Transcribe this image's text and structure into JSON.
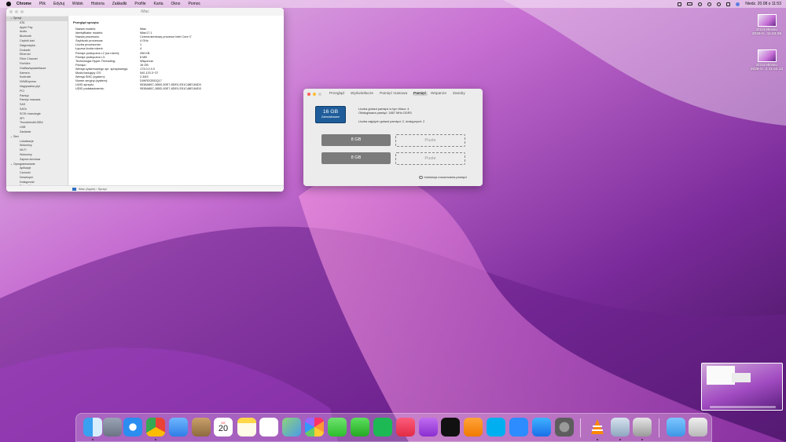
{
  "menubar": {
    "items": [
      "Chrome",
      "Plik",
      "Edytuj",
      "Widok",
      "Historia",
      "Zakładki",
      "Profile",
      "Karta",
      "Okno",
      "Pomoc"
    ],
    "clock": "Niedz. 20.08 o 11:53",
    "icons": [
      "screen-mirror-icon",
      "battery-icon",
      "wifi-icon",
      "bluetooth-icon",
      "search-icon",
      "control-center-icon",
      "siri-icon"
    ]
  },
  "sysinfo": {
    "title": "iMac",
    "sidebar": [
      {
        "label": "Sprzęt",
        "type": "h",
        "selected": true
      },
      {
        "label": "ATA",
        "type": "c"
      },
      {
        "label": "Apple Pay",
        "type": "c"
      },
      {
        "label": "Audio",
        "type": "c"
      },
      {
        "label": "Bluetooth",
        "type": "c"
      },
      {
        "label": "Czytnik kart",
        "type": "c"
      },
      {
        "label": "Diagnostyka",
        "type": "c"
      },
      {
        "label": "Drukarki",
        "type": "c"
      },
      {
        "label": "Ethernet",
        "type": "c"
      },
      {
        "label": "Fibre Channel",
        "type": "c"
      },
      {
        "label": "FireWire",
        "type": "c"
      },
      {
        "label": "Grafika/wyświetlacze",
        "type": "c"
      },
      {
        "label": "Kamera",
        "type": "c"
      },
      {
        "label": "Kontroler",
        "type": "c"
      },
      {
        "label": "NVMExpress",
        "type": "c"
      },
      {
        "label": "Nagrywarka płyt",
        "type": "c"
      },
      {
        "label": "PCI",
        "type": "c"
      },
      {
        "label": "Pamięć",
        "type": "c"
      },
      {
        "label": "Pamięć masowa",
        "type": "c"
      },
      {
        "label": "SAS",
        "type": "c"
      },
      {
        "label": "SATA",
        "type": "c"
      },
      {
        "label": "SCSI równoległe",
        "type": "c"
      },
      {
        "label": "SPI",
        "type": "c"
      },
      {
        "label": "Thunderbolt/USB4",
        "type": "c"
      },
      {
        "label": "USB",
        "type": "c"
      },
      {
        "label": "Zasilanie",
        "type": "c"
      },
      {
        "label": "Sieć",
        "type": "h"
      },
      {
        "label": "Lokalizacje",
        "type": "c"
      },
      {
        "label": "Woluminy",
        "type": "c"
      },
      {
        "label": "Wi-Fi",
        "type": "c"
      },
      {
        "label": "Woluminy",
        "type": "c"
      },
      {
        "label": "Zapora sieciowa",
        "type": "c"
      },
      {
        "label": "Oprogramowanie",
        "type": "h"
      },
      {
        "label": "Aplikacje",
        "type": "c"
      },
      {
        "label": "Czcionki",
        "type": "c"
      },
      {
        "label": "Deweloper",
        "type": "c"
      },
      {
        "label": "Dostępność",
        "type": "c"
      },
      {
        "label": "Dzienniki",
        "type": "c"
      }
    ],
    "content_title": "Przegląd sprzętu:",
    "rows": [
      {
        "k": "Nazwa modelu:",
        "v": "iMac"
      },
      {
        "k": "Identyfikator modelu:",
        "v": "iMac17,1"
      },
      {
        "k": "Nazwa procesora:",
        "v": "Czterordzeniowy procesor Intel Core i7"
      },
      {
        "k": "Szybkość procesora:",
        "v": "4 GHz"
      },
      {
        "k": "Liczba procesorów:",
        "v": "1"
      },
      {
        "k": "Łączna liczba rdzeni:",
        "v": "4"
      },
      {
        "k": "Pamięć podręczna L2 (na rdzeń):",
        "v": "256 KB"
      },
      {
        "k": "Pamięć podręczna L3:",
        "v": "8 MB"
      },
      {
        "k": "Technologia Hyper-Threading:",
        "v": "Włączona"
      },
      {
        "k": "Pamięć:",
        "v": "16 GB"
      },
      {
        "k": "Wersja systemowego opr. sprzętowego:",
        "v": "173.0.0.0.0"
      },
      {
        "k": "Moduł ładujący OS:",
        "v": "540.120.3~37"
      },
      {
        "k": "Wersja SMC (system):",
        "v": "2.34f3"
      },
      {
        "k": "Numer seryjny (system):",
        "v": "D0KR2GBGQ17"
      },
      {
        "k": "UUID sprzętu:",
        "v": "9538A80C-365D-50E7-8DE0-E51C48E184D0"
      },
      {
        "k": "UDID podwładczenia:",
        "v": "9538A80C-365D-50E7-8DE0-E51C48E184D0"
      }
    ],
    "breadcrumb": "iMac (Apple) › Sprzęt"
  },
  "about": {
    "tabs": [
      "Przegląd",
      "Wyświetlacze",
      "Pamięć masowa",
      "Pamięć",
      "Wsparcie",
      "Zasoby"
    ],
    "active_tab": 3,
    "chip_size": "16 GB",
    "chip_label": "Zainstalowane",
    "info1": "Liczba gniazd pamięci w tym Macu: 4",
    "info2": "Obsługiwana pamięć: 1867 MHz DDR3",
    "info3": "Liczba zajętych gniazd pamięci: 2, dostępnych: 2",
    "slots": [
      "8 GB",
      "8 GB"
    ],
    "empty": [
      "Puste",
      "Puste"
    ],
    "help": "Instrukcja rozszerzania pamięci"
  },
  "desktop": {
    "items": [
      "Zrzut ekranu\n2026-0...11.53.05",
      "Zrzut ekranu\n2026-0...o 11.53.13"
    ]
  },
  "dock": {
    "apps": [
      "finder-icon",
      "launchpad-icon",
      "safari-icon",
      "chrome-icon",
      "mail-icon",
      "contacts-icon",
      "calendar-icon",
      "notes-icon",
      "reminders-icon",
      "maps-icon",
      "photos-icon",
      "messages-icon",
      "facetime-icon",
      "spotify-icon",
      "music-icon",
      "podcasts-icon",
      "appletv-icon",
      "books-icon",
      "skype-icon",
      "zoom-icon",
      "appstore-icon",
      "settings-icon",
      "vlc-icon",
      "preview-icon",
      "printer-icon",
      "folder-icon",
      "trash-icon"
    ],
    "calendar_day": "20",
    "calendar_month": "SIE"
  },
  "colors": {
    "chip": "#1f5d9a",
    "slot": "#7b7b7b",
    "wallpaper_dark": "#5a1a7a",
    "wallpaper_light": "#e98ae6"
  }
}
